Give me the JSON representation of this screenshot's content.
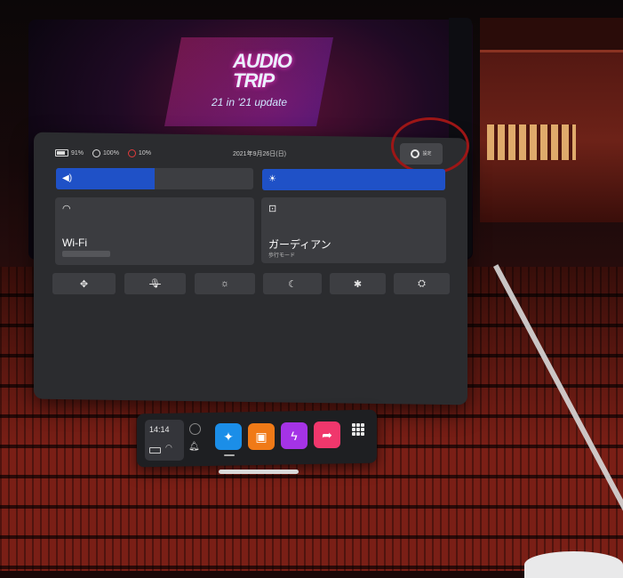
{
  "background": {
    "game_logo_line1": "AUDIO",
    "game_logo_line2": "TRIP",
    "game_subtitle": "21 in '21 update"
  },
  "status_bar": {
    "headset_battery": "91%",
    "left_controller_battery": "100%",
    "right_controller_battery": "10%",
    "date": "2021年9月26日(日)"
  },
  "settings_button": {
    "icon": "gear-icon",
    "label": "設定"
  },
  "sliders": {
    "volume": {
      "icon": "volume-icon",
      "level": 0.5
    },
    "brightness": {
      "icon": "brightness-icon",
      "level": 1.0
    }
  },
  "tiles": {
    "wifi": {
      "icon": "wifi-icon",
      "title": "Wi-Fi"
    },
    "guardian": {
      "icon": "guardian-icon",
      "title": "ガーディアン",
      "subtitle": "歩行モード"
    }
  },
  "quick_buttons": [
    {
      "name": "recenter",
      "icon": "move-icon",
      "glyph": "✥"
    },
    {
      "name": "mic-mute",
      "icon": "mic-off-icon",
      "glyph": "🎙"
    },
    {
      "name": "brightness",
      "icon": "sun-icon",
      "glyph": "☼"
    },
    {
      "name": "night-mode",
      "icon": "moon-icon",
      "glyph": "☾"
    },
    {
      "name": "bug-report",
      "icon": "bug-icon",
      "glyph": "✱"
    },
    {
      "name": "passthrough",
      "icon": "passthrough-icon",
      "glyph": "⛭"
    }
  ],
  "dock": {
    "time": "14:14",
    "apps": [
      {
        "name": "explore",
        "icon": "compass-icon",
        "glyph": "✦",
        "color": "#1b8ee8"
      },
      {
        "name": "store",
        "icon": "store-icon",
        "glyph": "▣",
        "color": "#f07a17"
      },
      {
        "name": "messenger",
        "icon": "messenger-icon",
        "glyph": "ϟ",
        "color": "#a533e6"
      },
      {
        "name": "share",
        "icon": "share-icon",
        "glyph": "➦",
        "color": "#f0376c"
      }
    ]
  },
  "colors": {
    "accent_blue": "#1f51c7",
    "panel_bg": "#2b2c2f",
    "tile_bg": "#3b3c40"
  }
}
